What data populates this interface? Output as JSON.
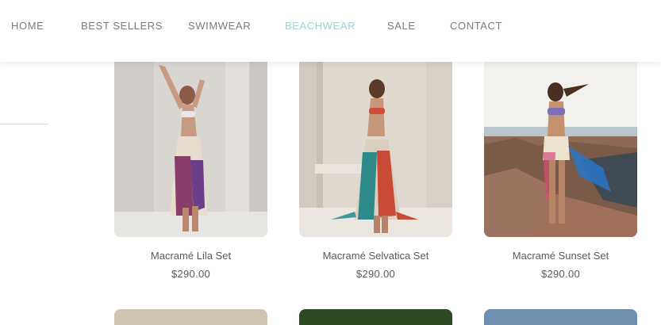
{
  "nav": {
    "items": [
      {
        "label": "HOME"
      },
      {
        "label": "BEST SELLERS"
      },
      {
        "label": "SWIMWEAR"
      },
      {
        "label": "BEACHWEAR",
        "active": true
      },
      {
        "label": "SALE"
      },
      {
        "label": "CONTACT"
      }
    ],
    "active_color": "#9fd0d4"
  },
  "products": [
    {
      "name": "Macramé Lila Set",
      "price": "$290.00"
    },
    {
      "name": "Macramé Selvatica Set",
      "price": "$290.00"
    },
    {
      "name": "Macramé Sunset Set",
      "price": "$290.00"
    }
  ]
}
